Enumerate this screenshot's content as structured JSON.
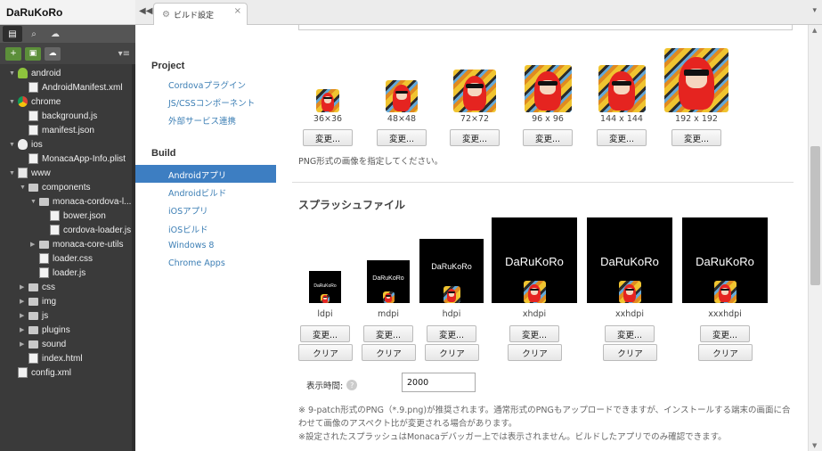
{
  "project": {
    "name": "DaRuKoRo"
  },
  "left_tabs": [
    "files-icon",
    "search-icon",
    "cloud-icon"
  ],
  "tree": [
    {
      "label": "android",
      "depth": 0,
      "icon": "android",
      "arrow": "▼"
    },
    {
      "label": "AndroidManifest.xml",
      "depth": 1,
      "icon": "file"
    },
    {
      "label": "chrome",
      "depth": 0,
      "icon": "chrome",
      "arrow": "▼"
    },
    {
      "label": "background.js",
      "depth": 1,
      "icon": "file"
    },
    {
      "label": "manifest.json",
      "depth": 1,
      "icon": "file"
    },
    {
      "label": "ios",
      "depth": 0,
      "icon": "apple",
      "arrow": "▼"
    },
    {
      "label": "MonacaApp-Info.plist",
      "depth": 1,
      "icon": "file"
    },
    {
      "label": "www",
      "depth": 0,
      "icon": "www",
      "arrow": "▼"
    },
    {
      "label": "components",
      "depth": 1,
      "icon": "folder",
      "arrow": "▼"
    },
    {
      "label": "monaca-cordova-l...",
      "depth": 2,
      "icon": "folder",
      "arrow": "▼"
    },
    {
      "label": "bower.json",
      "depth": 3,
      "icon": "file"
    },
    {
      "label": "cordova-loader.js",
      "depth": 3,
      "icon": "file"
    },
    {
      "label": "monaca-core-utils",
      "depth": 2,
      "icon": "folder",
      "arrow": "▶"
    },
    {
      "label": "loader.css",
      "depth": 2,
      "icon": "file"
    },
    {
      "label": "loader.js",
      "depth": 2,
      "icon": "file"
    },
    {
      "label": "css",
      "depth": 1,
      "icon": "folder",
      "arrow": "▶"
    },
    {
      "label": "img",
      "depth": 1,
      "icon": "folder",
      "arrow": "▶"
    },
    {
      "label": "js",
      "depth": 1,
      "icon": "folder",
      "arrow": "▶"
    },
    {
      "label": "plugins",
      "depth": 1,
      "icon": "folder",
      "arrow": "▶"
    },
    {
      "label": "sound",
      "depth": 1,
      "icon": "folder",
      "arrow": "▶"
    },
    {
      "label": "index.html",
      "depth": 1,
      "icon": "file"
    },
    {
      "label": "config.xml",
      "depth": 0,
      "icon": "file"
    }
  ],
  "tab": {
    "title": "ビルド設定",
    "close": "×",
    "collapse": "◀◀",
    "menu": "▾"
  },
  "nav": {
    "project_heading": "Project",
    "project_items": [
      "Cordovaプラグイン",
      "JS/CSSコンポーネント",
      "外部サービス連携"
    ],
    "build_heading": "Build",
    "active_item": "Androidアプリ",
    "build_items": [
      "Androidビルド",
      "iOSアプリ",
      "iOSビルド",
      "Windows 8",
      "Chrome Apps"
    ]
  },
  "icons": {
    "sizes": [
      "36×36",
      "48×48",
      "72×72",
      "96 x 96",
      "144 x 144",
      "192 x 192"
    ],
    "change_label": "変更...",
    "hint": "PNG形式の画像を指定してください。"
  },
  "splash": {
    "title": "スプラッシュファイル",
    "app_name": "DaRuKoRo",
    "densities": [
      "ldpi",
      "mdpi",
      "hdpi",
      "xhdpi",
      "xxhdpi",
      "xxxhdpi"
    ],
    "change_label": "変更...",
    "clear_label": "クリア",
    "duration_label": "表示時間:",
    "duration_value": "2000",
    "help": "?",
    "note1": "※ 9-patch形式のPNG（*.9.png)が推奨されます。通常形式のPNGもアップロードできますが、インストールする端末の画面に合わせて画像のアスペクト比が変更される場合があります。",
    "note2": "※設定されたスプラッシュはMonacaデバッガー上では表示されません。ビルドしたアプリでのみ確認できます。"
  }
}
